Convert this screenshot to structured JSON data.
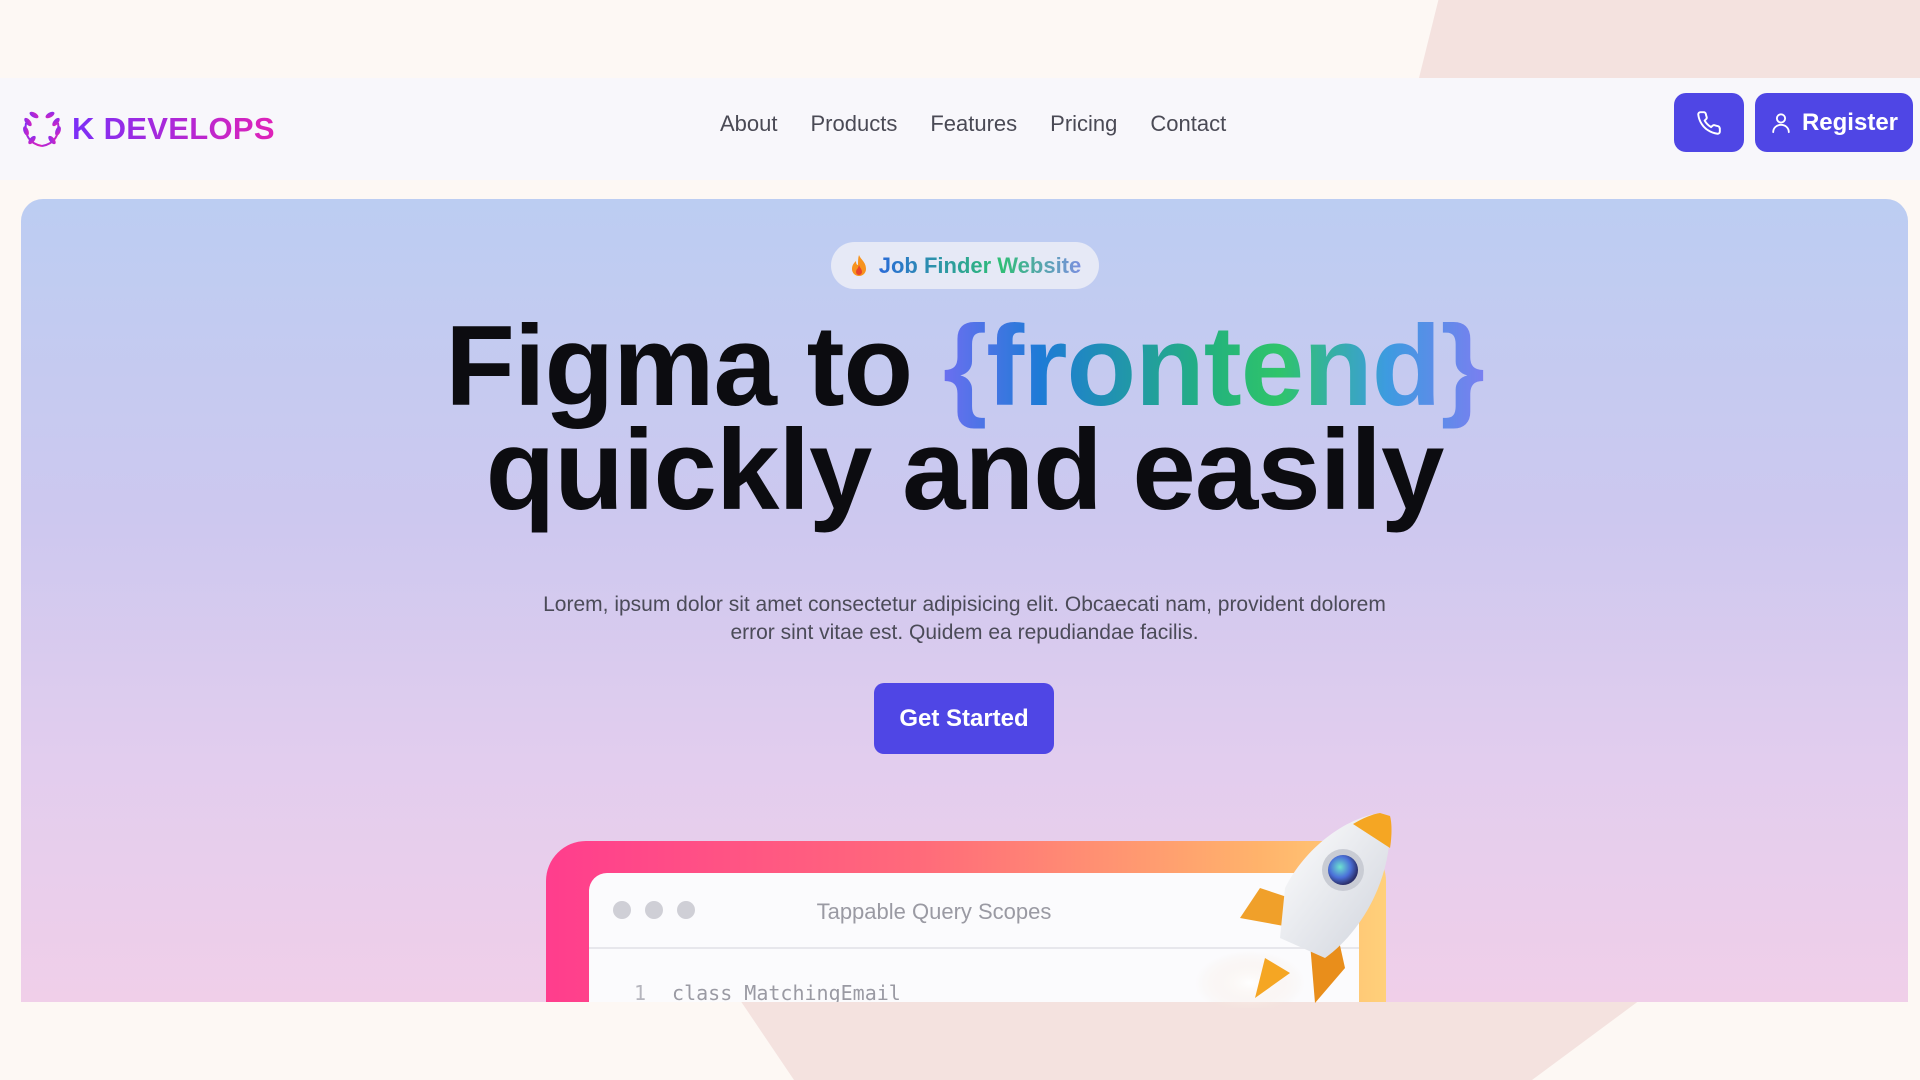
{
  "brand": {
    "name": "K DEVELOPS"
  },
  "nav": {
    "links": [
      "About",
      "Products",
      "Features",
      "Pricing",
      "Contact"
    ],
    "register_label": "Register"
  },
  "hero": {
    "badge_text": "Job Finder Website",
    "headline_part1": "Figma to ",
    "headline_highlight": "{frontend}",
    "headline_line2": "quickly and easily",
    "subtext": "Lorem, ipsum dolor sit amet consectetur adipisicing elit. Obcaecati nam, provident dolorem error sint vitae est. Quidem ea repudiandae facilis.",
    "cta_label": "Get Started"
  },
  "preview": {
    "window_title": "Tappable Query Scopes",
    "code_line_number": "1",
    "code_line_text": "class MatchingEmail"
  },
  "colors": {
    "primary": "#4f46e5",
    "brand_gradient_start": "#7b2ff7",
    "brand_gradient_end": "#e022b8"
  },
  "icons": {
    "logo": "laurel-wreath-icon",
    "phone": "phone-icon",
    "user": "user-icon",
    "badge": "fire-icon",
    "decoration": "rocket-icon"
  }
}
